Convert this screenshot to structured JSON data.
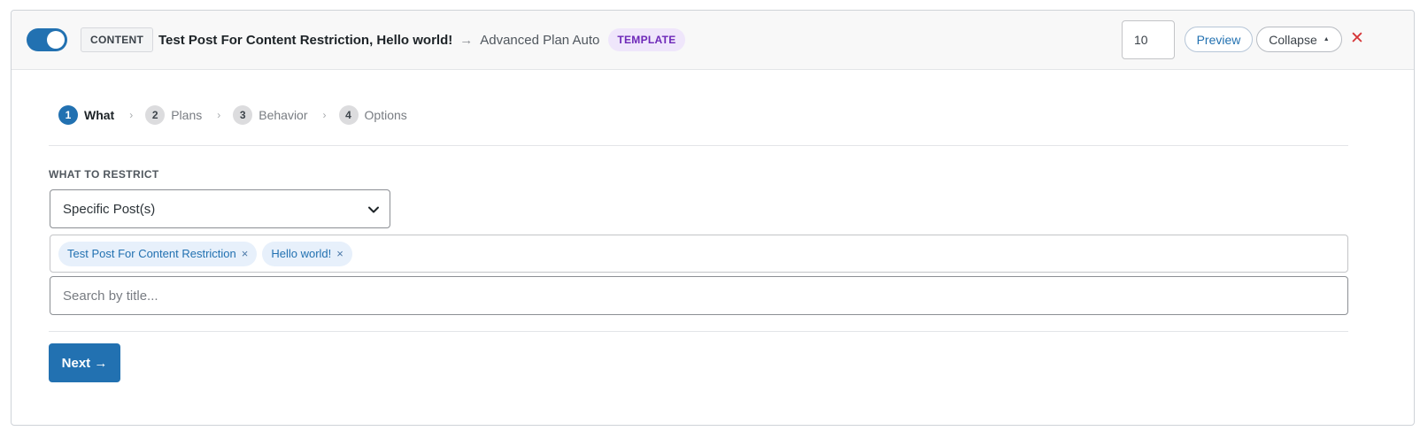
{
  "header": {
    "toggle_state": "on",
    "type_badge": "CONTENT",
    "rule_title": "Test Post For Content Restriction, Hello world!",
    "arrow": "→",
    "plan_name": "Advanced Plan Auto",
    "template_badge": "TEMPLATE",
    "priority_value": "10",
    "preview_label": "Preview",
    "collapse_label": "Collapse",
    "collapse_icon": "caret-up-icon",
    "close_icon": "close-icon"
  },
  "steps": [
    {
      "number": "1",
      "label": "What",
      "active": true
    },
    {
      "number": "2",
      "label": "Plans",
      "active": false
    },
    {
      "number": "3",
      "label": "Behavior",
      "active": false
    },
    {
      "number": "4",
      "label": "Options",
      "active": false
    }
  ],
  "step_separator": "›",
  "restrict": {
    "section_label": "WHAT TO RESTRICT",
    "select_value": "Specific Post(s)",
    "selected_posts": [
      {
        "label": "Test Post For Content Restriction"
      },
      {
        "label": "Hello world!"
      }
    ],
    "token_remove": "×",
    "search_placeholder": "Search by title..."
  },
  "footer": {
    "next_label": "Next →"
  },
  "colors": {
    "accent": "#2271b1",
    "template_badge_bg": "#efe6fb",
    "template_badge_text": "#6d28b8",
    "close": "#d63638",
    "token_bg": "#e7f0fb"
  }
}
